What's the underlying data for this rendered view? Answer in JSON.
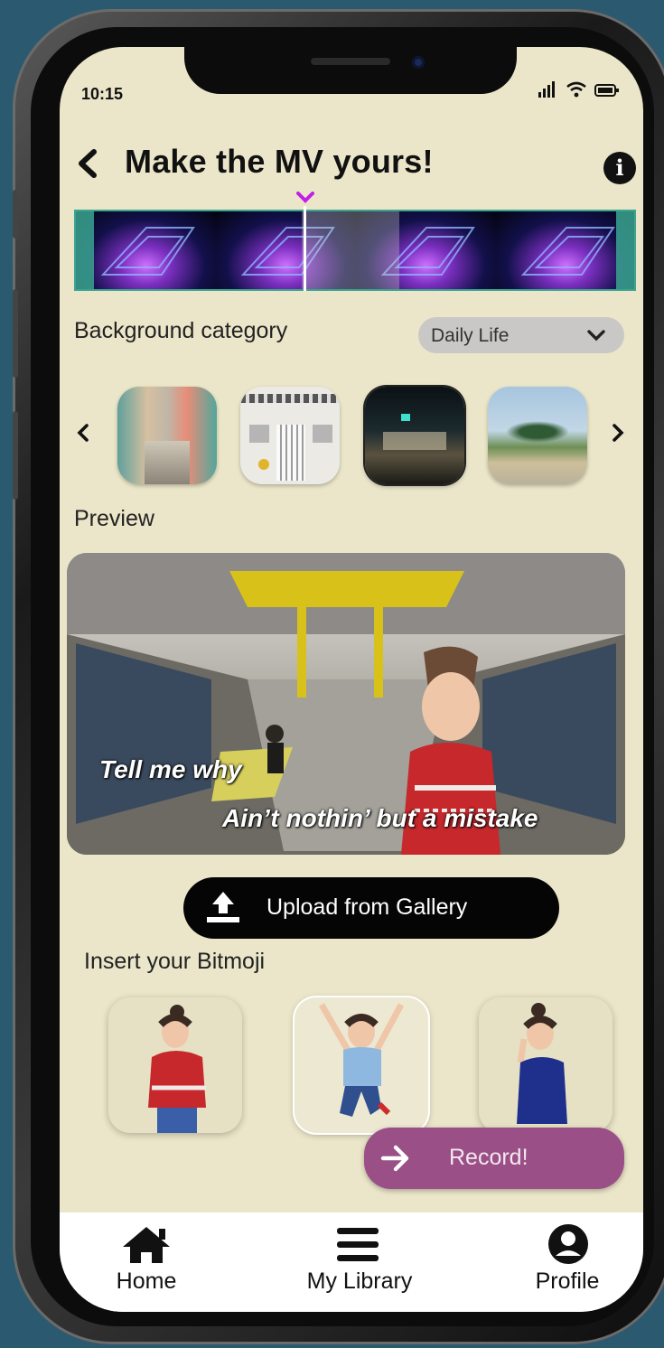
{
  "status_bar": {
    "time": "10:15"
  },
  "header": {
    "title": "Make the MV yours!",
    "info_symbol": "i"
  },
  "timeline": {
    "playhead_position": 0.41
  },
  "background": {
    "label": "Background category",
    "dropdown_value": "Daily Life",
    "thumbnails": [
      "colorful-street",
      "white-shophouse-door",
      "night-street",
      "palm-trees-field"
    ],
    "selected_index": 2
  },
  "preview": {
    "label": "Preview",
    "lyric_line_1": "Tell me why",
    "lyric_line_2": "Ain’t nothin’ but a mistake"
  },
  "upload": {
    "label": "Upload from Gallery"
  },
  "bitmoji": {
    "label": "Insert your Bitmoji",
    "options": [
      "thinking-pose",
      "jumping-pose",
      "peace-sign-pose"
    ],
    "selected_index": 1
  },
  "record": {
    "label": "Record!"
  },
  "nav": {
    "home": "Home",
    "library": "My Library",
    "profile": "Profile"
  },
  "colors": {
    "background": "#ebe6c9",
    "accent": "#9b4f87",
    "timeline_border": "#3aa590",
    "marker": "#c21ee8"
  }
}
